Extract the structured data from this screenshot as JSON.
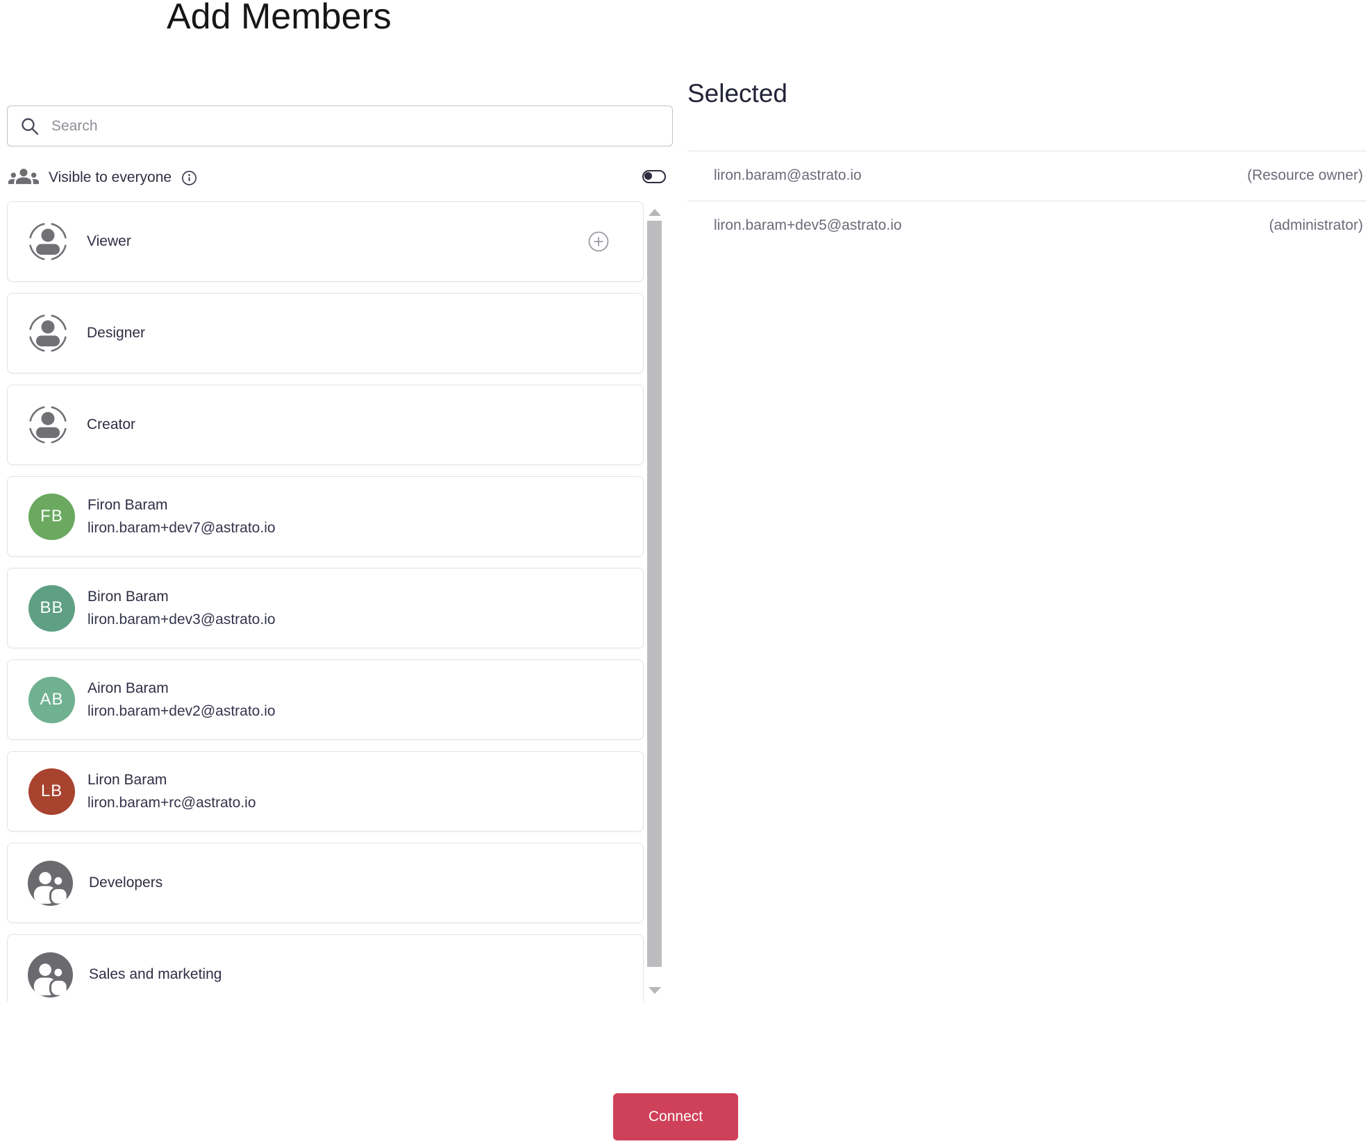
{
  "title": "Add Members",
  "search": {
    "placeholder": "Search"
  },
  "visibility": {
    "label": "Visible to everyone",
    "enabled": false
  },
  "list": {
    "items": [
      {
        "type": "role",
        "label": "Viewer"
      },
      {
        "type": "role",
        "label": "Designer"
      },
      {
        "type": "role",
        "label": "Creator"
      },
      {
        "type": "user",
        "initials": "FB",
        "name": "Firon Baram",
        "email": "liron.baram+dev7@astrato.io",
        "color": "#6aa95f"
      },
      {
        "type": "user",
        "initials": "BB",
        "name": "Biron Baram",
        "email": "liron.baram+dev3@astrato.io",
        "color": "#5fa085"
      },
      {
        "type": "user",
        "initials": "AB",
        "name": "Airon Baram",
        "email": "liron.baram+dev2@astrato.io",
        "color": "#6fb191"
      },
      {
        "type": "user",
        "initials": "LB",
        "name": "Liron Baram",
        "email": "liron.baram+rc@astrato.io",
        "color": "#a8432f"
      },
      {
        "type": "group",
        "label": "Developers"
      },
      {
        "type": "group",
        "label": "Sales and marketing"
      }
    ]
  },
  "selected": {
    "heading": "Selected",
    "rows": [
      {
        "email": "liron.baram@astrato.io",
        "role": "(Resource owner)"
      },
      {
        "email": "liron.baram+dev5@astrato.io",
        "role": "(administrator)"
      }
    ]
  },
  "footer": {
    "connect_label": "Connect"
  },
  "colors": {
    "primary_button": "#cf4059",
    "toggle": "#2b2b40",
    "scrollbar_thumb": "#bdbdc0",
    "icon_gray": "#6a6a6f",
    "text_dark": "#2e2e45",
    "text_muted": "#6b6b78"
  }
}
